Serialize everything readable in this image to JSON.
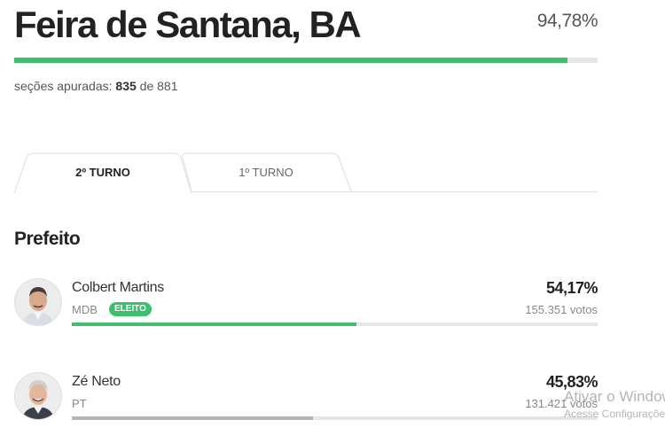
{
  "header": {
    "city": "Feira de Santana, BA",
    "percent_counted": "94,78%",
    "progress_fraction": 0.9478,
    "sections_label": "seções apuradas:",
    "sections_counted": "835",
    "sections_of": "de",
    "sections_total": "881"
  },
  "tabs": [
    {
      "label": "2º TURNO",
      "active": true
    },
    {
      "label": "1º TURNO",
      "active": false
    }
  ],
  "office": "Prefeito",
  "candidates": [
    {
      "name": "Colbert Martins",
      "party": "MDB",
      "badge": "ELEITO",
      "percent": "54,17%",
      "votes": "155.351 votos",
      "fraction": 0.5417,
      "bar_color": "#3dbf6e"
    },
    {
      "name": "Zé Neto",
      "party": "PT",
      "badge": "",
      "percent": "45,83%",
      "votes": "131.421 votos",
      "fraction": 0.4583,
      "bar_color": "#b5b5b5"
    }
  ],
  "watermark": {
    "line1": "Ativar o Windows",
    "line2": "Acesse Configurações"
  },
  "colors": {
    "accent_green": "#3dbf6e",
    "bar_track": "#e6e6e6",
    "loser_bar": "#b5b5b5"
  }
}
